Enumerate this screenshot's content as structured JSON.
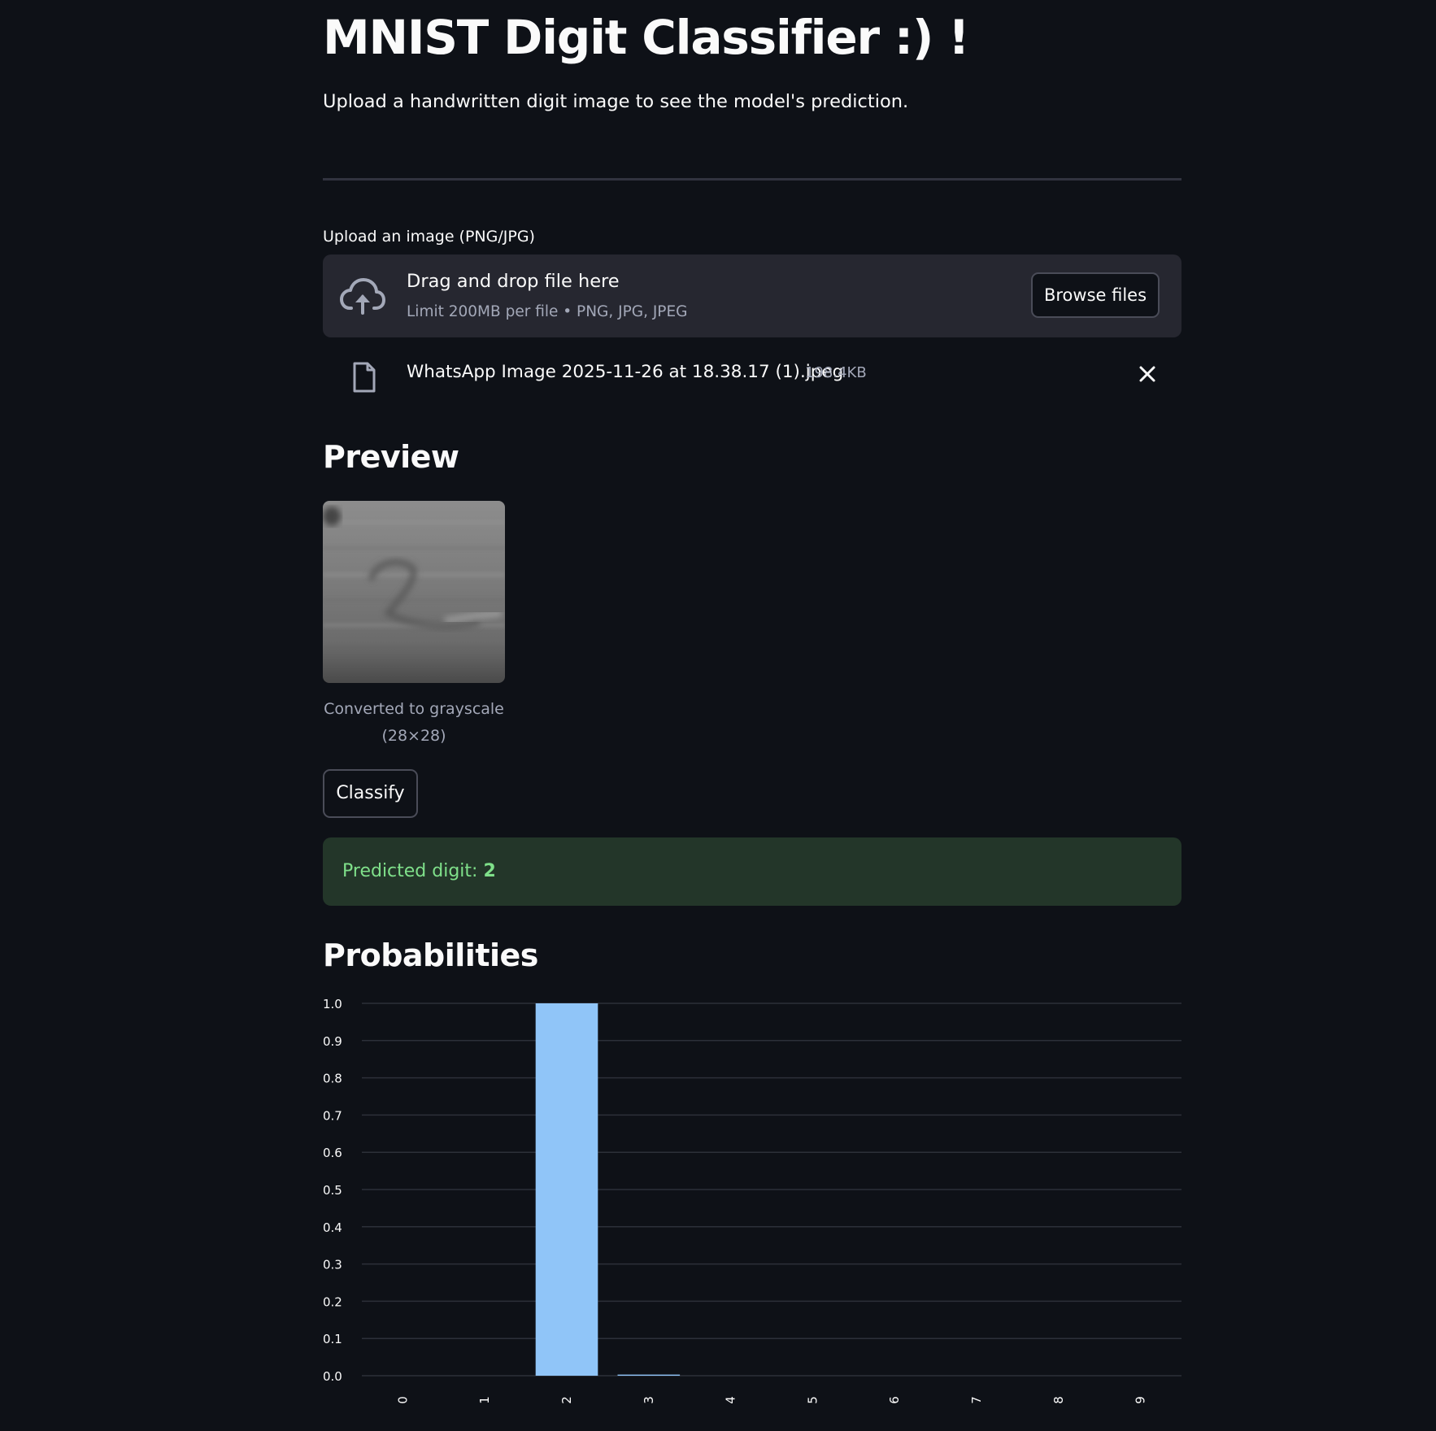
{
  "page": {
    "title": "MNIST Digit Classifier :) !",
    "subtitle": "Upload a handwritten digit image to see the model's prediction."
  },
  "uploader": {
    "label": "Upload an image (PNG/JPG)",
    "drop_title": "Drag and drop file here",
    "drop_limit": "Limit 200MB per file • PNG, JPG, JPEG",
    "browse_label": "Browse files",
    "upload_icon": "cloud-upload-icon"
  },
  "uploaded_file": {
    "name": "WhatsApp Image 2025-11-26 at 18.38.17 (1).jpeg",
    "size": "198.4KB",
    "file_icon": "file-icon",
    "remove_icon": "close-icon"
  },
  "preview": {
    "heading": "Preview",
    "caption_line1": "Converted to grayscale",
    "caption_line2": "(28×28)"
  },
  "actions": {
    "classify_label": "Classify"
  },
  "result": {
    "prefix": "Predicted digit: ",
    "digit": "2",
    "color": "#7fe08a",
    "background": "#233629"
  },
  "probabilities": {
    "heading": "Probabilities"
  },
  "colors": {
    "background": "#0e1117",
    "surface": "#262730",
    "bar": "#90c5f8",
    "muted_text": "#a3a8b8",
    "grid": "#2c3039"
  },
  "chart_data": {
    "type": "bar",
    "title": "",
    "xlabel": "",
    "ylabel": "",
    "categories": [
      "0",
      "1",
      "2",
      "3",
      "4",
      "5",
      "6",
      "7",
      "8",
      "9"
    ],
    "values": [
      0.0,
      0.0,
      1.0,
      0.003,
      0.0,
      0.0,
      0.0,
      0.0,
      0.0,
      0.0
    ],
    "ylim": [
      0,
      1.0
    ],
    "yticks": [
      "0.0",
      "0.1",
      "0.2",
      "0.3",
      "0.4",
      "0.5",
      "0.6",
      "0.7",
      "0.8",
      "0.9",
      "1.0"
    ],
    "grid": true,
    "legend": "none"
  }
}
